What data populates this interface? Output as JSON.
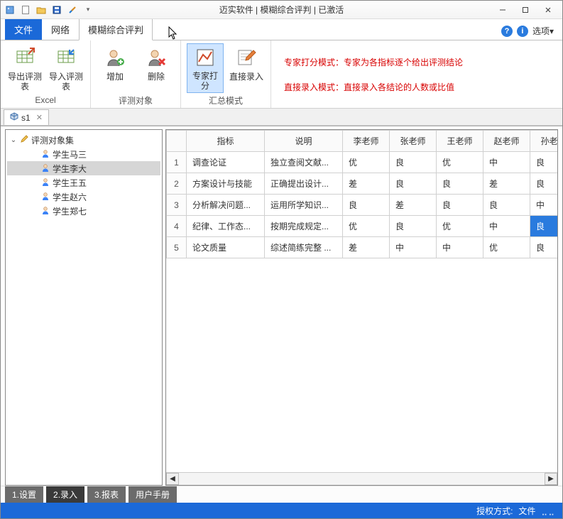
{
  "titlebar": {
    "app_title": "迈实软件 | 模糊综合评判 | 已激活"
  },
  "qat": {
    "new": "new-icon",
    "open": "open-icon",
    "save": "save-icon",
    "tools": "tools-icon"
  },
  "menu": {
    "file": "文件",
    "network": "网络",
    "fuzzy": "模糊综合评判",
    "help_q": "?",
    "help_i": "i",
    "options": "选项",
    "options_arrow": "▾"
  },
  "ribbon": {
    "groups": {
      "excel": {
        "name": "Excel",
        "export": "导出评测表",
        "import": "导入评测表"
      },
      "subject": {
        "name": "评测对象",
        "add": "增加",
        "delete": "删除"
      },
      "mode": {
        "name": "汇总模式",
        "expert": "专家打分",
        "direct": "直接录入"
      }
    },
    "info1_label": "专家打分模式：",
    "info1_desc": "专家为各指标逐个给出评测结论",
    "info2_label": "直接录入模式：",
    "info2_desc": "直接录入各结论的人数或比值"
  },
  "doctab": {
    "name": "s1",
    "close": "✕"
  },
  "tree": {
    "root": "评测对象集",
    "nodes": [
      {
        "label": "学生马三"
      },
      {
        "label": "学生李大",
        "selected": true
      },
      {
        "label": "学生王五"
      },
      {
        "label": "学生赵六"
      },
      {
        "label": "学生郑七"
      }
    ]
  },
  "table": {
    "headers": [
      "指标",
      "说明",
      "李老师",
      "张老师",
      "王老师",
      "赵老师",
      "孙老师"
    ],
    "rows": [
      {
        "n": "1",
        "cells": [
          "调查论证",
          "独立查阅文献...",
          "优",
          "良",
          "优",
          "中",
          "良"
        ]
      },
      {
        "n": "2",
        "cells": [
          "方案设计与技能",
          "正确提出设计...",
          "差",
          "良",
          "良",
          "差",
          "良"
        ]
      },
      {
        "n": "3",
        "cells": [
          "分析解决问题...",
          "运用所学知识...",
          "良",
          "差",
          "良",
          "良",
          "中"
        ]
      },
      {
        "n": "4",
        "cells": [
          "纪律、工作态...",
          "按期完成规定...",
          "优",
          "良",
          "优",
          "中",
          "良"
        ],
        "active_col": 6
      },
      {
        "n": "5",
        "cells": [
          "论文质量",
          "综述简练完整 ...",
          "差",
          "中",
          "中",
          "优",
          "良"
        ]
      }
    ]
  },
  "bottom_tabs": [
    "1.设置",
    "2.录入",
    "3.报表",
    "用户手册"
  ],
  "bottom_active_index": 1,
  "status": {
    "auth_label": "授权方式:",
    "auth_value": "文件"
  }
}
